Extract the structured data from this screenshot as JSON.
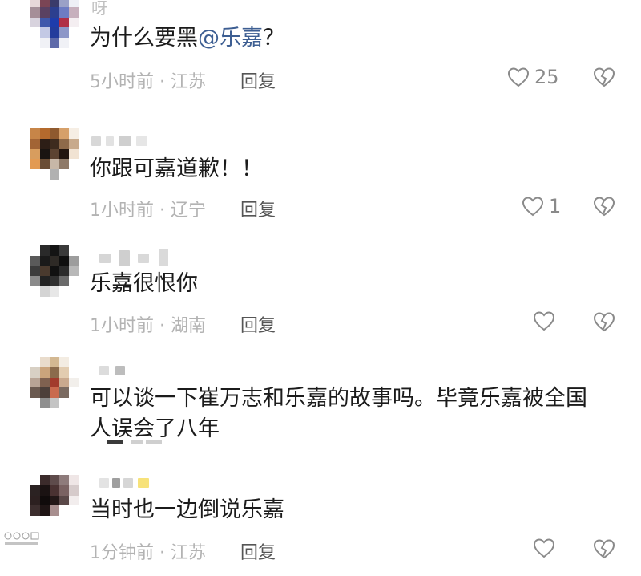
{
  "comments": [
    {
      "username": "呀",
      "segments": [
        "为什么要黑",
        "@乐嘉",
        "？"
      ],
      "time": "5小时前",
      "location": "江苏",
      "reply_label": "回复",
      "likes": "25"
    },
    {
      "username": "",
      "segments": [
        "你跟可嘉道歉！！"
      ],
      "time": "1小时前",
      "location": "辽宁",
      "reply_label": "回复",
      "likes": "1"
    },
    {
      "username": "",
      "segments": [
        "乐嘉很恨你"
      ],
      "time": "1小时前",
      "location": "湖南",
      "reply_label": "回复",
      "likes": ""
    },
    {
      "username": "",
      "line1": "可以谈一下崔万志和乐嘉的故事吗。毕竟乐嘉被全国",
      "line2": "人误会了八年",
      "time": "",
      "location": "",
      "reply_label": "",
      "likes": ""
    },
    {
      "username": "",
      "segments": [
        "当时也一边倒说乐嘉"
      ],
      "time": "1分钟前",
      "location": "江苏",
      "reply_label": "回复",
      "likes": ""
    }
  ],
  "separator": "·",
  "icons": {
    "like": "heart-outline-icon",
    "dislike": "broken-heart-icon"
  },
  "colors": {
    "text": "#1b1b1b",
    "mention": "#3d5e92",
    "meta": "#b3b3b3",
    "icon": "#8a8a8a"
  }
}
